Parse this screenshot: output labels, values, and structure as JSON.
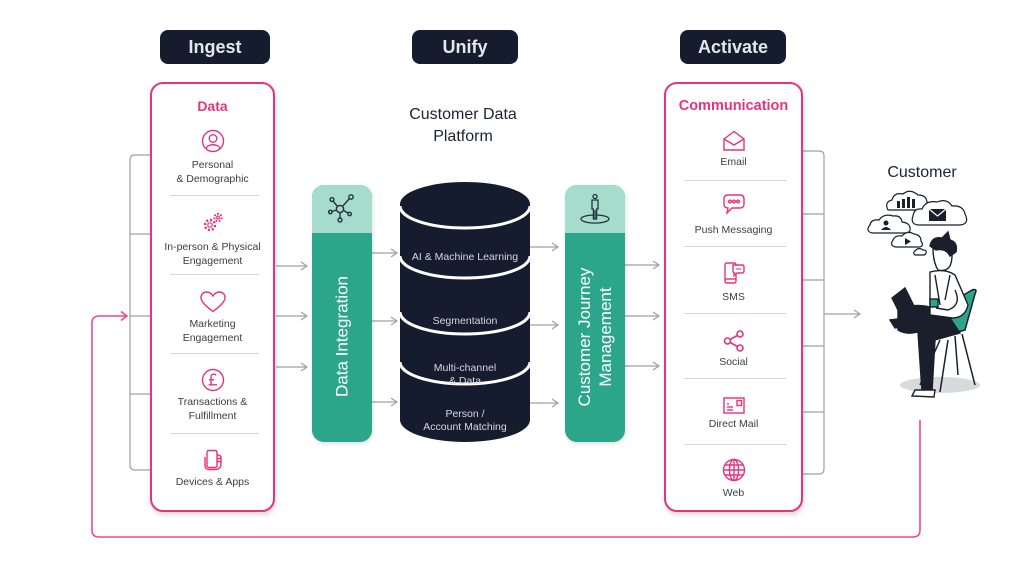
{
  "stages": {
    "ingest": "Ingest",
    "unify": "Unify",
    "activate": "Activate"
  },
  "data_panel": {
    "title": "Data",
    "items": [
      {
        "icon": "person-circle-icon",
        "lines": [
          "Personal",
          "& Demographic"
        ]
      },
      {
        "icon": "gears-icon",
        "lines": [
          "In-person & Physical",
          "Engagement"
        ]
      },
      {
        "icon": "heart-icon",
        "lines": [
          "Marketing",
          "Engagement"
        ]
      },
      {
        "icon": "pound-coin-icon",
        "lines": [
          "Transactions &",
          "Fulfillment"
        ]
      },
      {
        "icon": "phone-in-hand-icon",
        "lines": [
          "Devices & Apps"
        ]
      }
    ]
  },
  "integration": {
    "icon": "network-icon",
    "lines": [
      "Data Integration"
    ]
  },
  "cdp": {
    "title_lines": [
      "Customer Data",
      "Platform"
    ],
    "segments": [
      {
        "lines": [
          "AI & Machine Learning"
        ]
      },
      {
        "lines": [
          "Segmentation"
        ]
      },
      {
        "lines": [
          "Multi-channel",
          "& Data"
        ]
      },
      {
        "lines": [
          "Person /",
          "Account Matching"
        ]
      }
    ]
  },
  "journey": {
    "icon": "person-on-target-icon",
    "lines": [
      "Customer Journey",
      "Management"
    ]
  },
  "communication": {
    "title": "Communication",
    "items": [
      {
        "icon": "open-envelope-icon",
        "label": "Email"
      },
      {
        "icon": "chat-bubble-icon",
        "label": "Push Messaging"
      },
      {
        "icon": "sms-phone-icon",
        "label": "SMS"
      },
      {
        "icon": "share-icon",
        "label": "Social"
      },
      {
        "icon": "postcard-icon",
        "label": "Direct Mail"
      },
      {
        "icon": "globe-icon",
        "label": "Web"
      }
    ]
  },
  "customer": {
    "title": "Customer"
  },
  "colors": {
    "accent_pink": "#e6337c",
    "navy": "#151c2e",
    "teal": "#2ba68a",
    "light_teal": "#a6dccb",
    "connector_gray": "#9ea2a6"
  }
}
